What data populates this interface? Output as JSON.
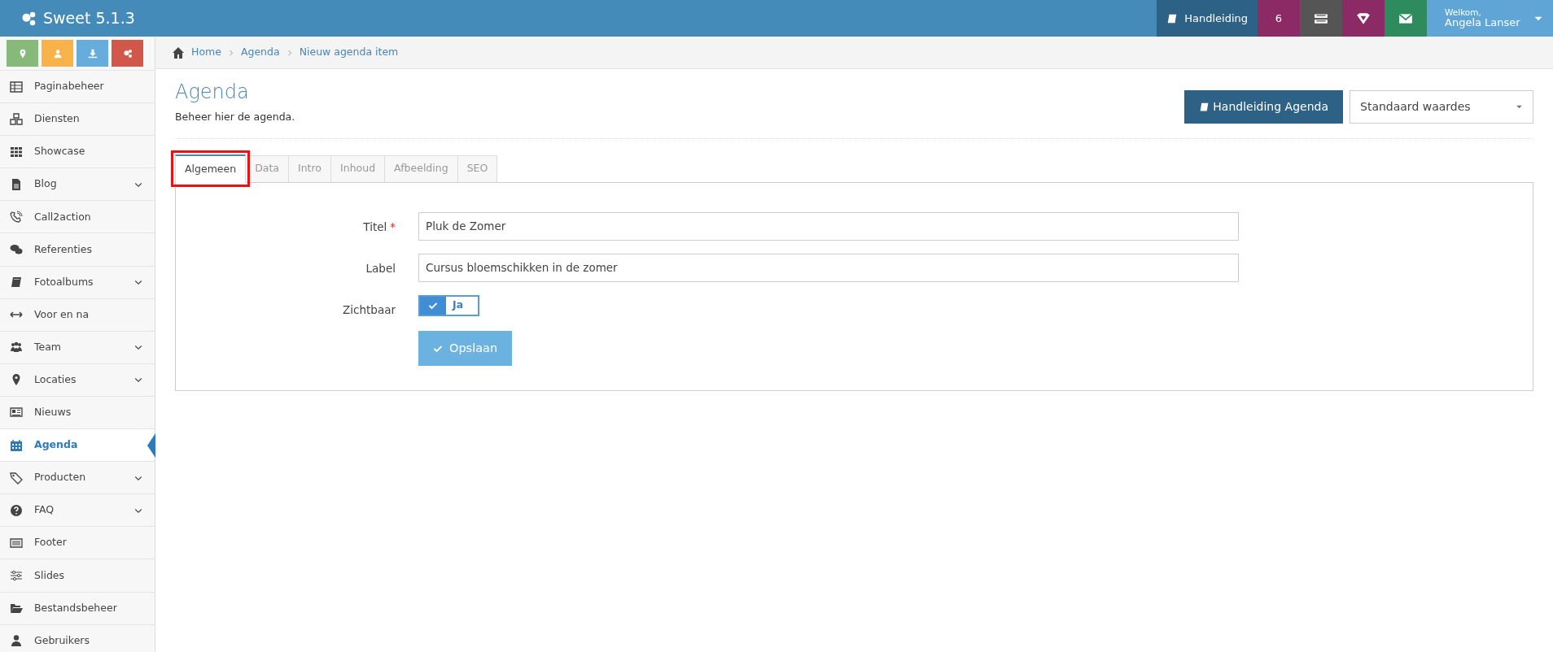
{
  "app": {
    "title": "Sweet 5.1.3"
  },
  "topbar": {
    "items": [
      {
        "kind": "text",
        "label": "Handleiding",
        "color": "#2e6186"
      },
      {
        "kind": "count",
        "label": "6",
        "color": "#8b2a64"
      },
      {
        "kind": "icon",
        "color": "#555555"
      },
      {
        "kind": "icon",
        "color": "#8b2a64"
      },
      {
        "kind": "icon",
        "color": "#2e8b5e"
      }
    ],
    "user": {
      "greeting": "Welkom,",
      "name": "Angela Lanser"
    }
  },
  "quick_buttons": [
    {
      "color": "#86b97a"
    },
    {
      "color": "#f7b24a"
    },
    {
      "color": "#66addd"
    },
    {
      "color": "#d0574a"
    }
  ],
  "breadcrumb": [
    "Home",
    "Agenda",
    "Nieuw agenda item"
  ],
  "sidebar": {
    "items": [
      {
        "label": "Paginabeheer",
        "submenu": false,
        "selected": false
      },
      {
        "label": "Diensten",
        "submenu": false,
        "selected": false
      },
      {
        "label": "Showcase",
        "submenu": false,
        "selected": false
      },
      {
        "label": "Blog",
        "submenu": true,
        "selected": false
      },
      {
        "label": "Call2action",
        "submenu": false,
        "selected": false
      },
      {
        "label": "Referenties",
        "submenu": false,
        "selected": false
      },
      {
        "label": "Fotoalbums",
        "submenu": true,
        "selected": false
      },
      {
        "label": "Voor en na",
        "submenu": false,
        "selected": false
      },
      {
        "label": "Team",
        "submenu": true,
        "selected": false
      },
      {
        "label": "Locaties",
        "submenu": true,
        "selected": false
      },
      {
        "label": "Nieuws",
        "submenu": false,
        "selected": false
      },
      {
        "label": "Agenda",
        "submenu": false,
        "selected": true
      },
      {
        "label": "Producten",
        "submenu": true,
        "selected": false
      },
      {
        "label": "FAQ",
        "submenu": true,
        "selected": false
      },
      {
        "label": "Footer",
        "submenu": false,
        "selected": false
      },
      {
        "label": "Slides",
        "submenu": false,
        "selected": false
      },
      {
        "label": "Bestandsbeheer",
        "submenu": false,
        "selected": false
      },
      {
        "label": "Gebruikers",
        "submenu": false,
        "selected": false
      }
    ]
  },
  "page": {
    "title": "Agenda",
    "subtitle": "Beheer hier de agenda.",
    "manual_button": "Handleiding Agenda",
    "preset_select": "Standaard waardes"
  },
  "tabs": [
    {
      "label": "Algemeen",
      "selected": true,
      "highlighted": true
    },
    {
      "label": "Data",
      "selected": false,
      "highlighted": false
    },
    {
      "label": "Intro",
      "selected": false,
      "highlighted": false
    },
    {
      "label": "Inhoud",
      "selected": false,
      "highlighted": false
    },
    {
      "label": "Afbeelding",
      "selected": false,
      "highlighted": false
    },
    {
      "label": "SEO",
      "selected": false,
      "highlighted": false
    }
  ],
  "form": {
    "fields": [
      {
        "kind": "text",
        "label": "Titel",
        "required_mark": "*",
        "value": "Pluk de Zomer"
      },
      {
        "kind": "text",
        "label": "Label",
        "value": "Cursus bloemschikken in de zomer"
      },
      {
        "kind": "toggle",
        "label": "Zichtbaar",
        "checked": true,
        "value": "Ja"
      }
    ],
    "save_button": "Opslaan"
  }
}
